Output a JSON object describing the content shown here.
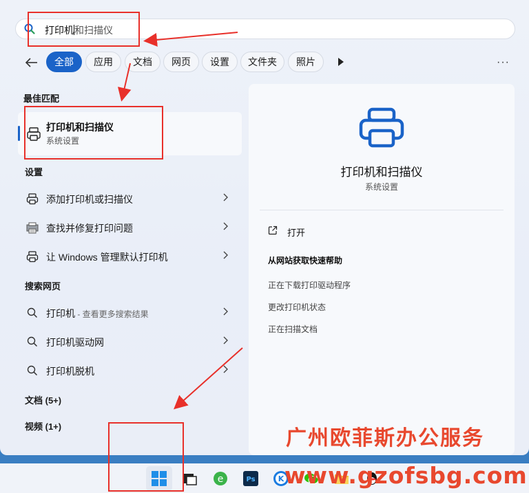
{
  "search": {
    "typed": "打印机",
    "hint": "和扫描仪"
  },
  "filters": [
    {
      "label": "全部",
      "active": true
    },
    {
      "label": "应用"
    },
    {
      "label": "文档"
    },
    {
      "label": "网页"
    },
    {
      "label": "设置"
    },
    {
      "label": "文件夹"
    },
    {
      "label": "照片"
    }
  ],
  "more_label": "···",
  "sections": {
    "best_match": "最佳匹配",
    "settings": "设置",
    "web": "搜索网页",
    "docs": "文档 (5+)",
    "videos": "视频 (1+)"
  },
  "best_match": {
    "title": "打印机和扫描仪",
    "subtitle": "系统设置"
  },
  "settings_items": [
    {
      "label": "添加打印机或扫描仪"
    },
    {
      "label": "查找并修复打印问题"
    },
    {
      "label": "让 Windows 管理默认打印机"
    }
  ],
  "web_items": [
    {
      "label": "打印机",
      "sub": " - 查看更多搜索结果"
    },
    {
      "label": "打印机驱动网"
    },
    {
      "label": "打印机脱机"
    }
  ],
  "detail": {
    "title": "打印机和扫描仪",
    "subtitle": "系统设置",
    "open_label": "打开",
    "help_title": "从网站获取快速帮助",
    "help_links": [
      "正在下载打印驱动程序",
      "更改打印机状态",
      "正在扫描文档"
    ]
  },
  "watermark": {
    "company": "广州欧菲斯办公服务",
    "site": "www.gzofsbg.com"
  },
  "colors": {
    "accent": "#1a63c8",
    "annotation": "#e8302a",
    "watermark": "#e8482e"
  },
  "taskbar_icons": [
    "windows-start-icon",
    "task-view-icon",
    "edge-icon",
    "photoshop-icon",
    "k-app-icon",
    "wechat-icon",
    "file-explorer-icon",
    "qq-icon"
  ]
}
